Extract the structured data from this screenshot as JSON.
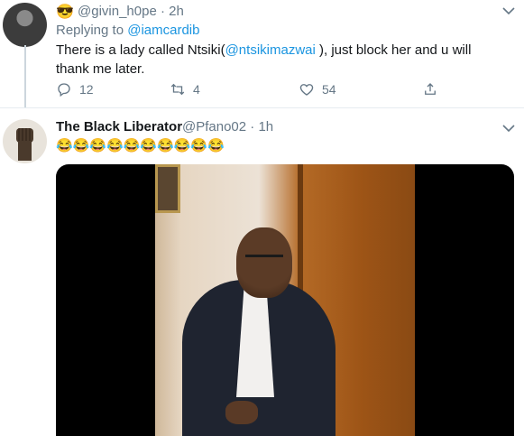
{
  "tweet1": {
    "emoji": "😎",
    "handle": "@givin_h0pe",
    "dot": "·",
    "time": "2h",
    "replying_prefix": "Replying to",
    "replying_handle": "@iamcardib",
    "text_before": "There is a lady called Ntsiki(",
    "mention": "@ntsikimazwai",
    "text_after": " ), just block her and u will thank me later.",
    "replies": "12",
    "retweets": "4",
    "likes": "54"
  },
  "tweet2": {
    "name": "The Black Liberator",
    "handle": "@Pfano02",
    "dot": "·",
    "time": "1h",
    "emojis": "😂😂😂😂😂😂😂😂😂😂"
  },
  "icons": {
    "menu": "chevron-down-icon",
    "reply": "reply-icon",
    "retweet": "retweet-icon",
    "like": "heart-icon",
    "share": "share-icon"
  },
  "colors": {
    "link": "#1b95e0",
    "secondary_text": "#657786",
    "divider": "#e6ecf0",
    "thread_line": "#ccd6dd"
  }
}
